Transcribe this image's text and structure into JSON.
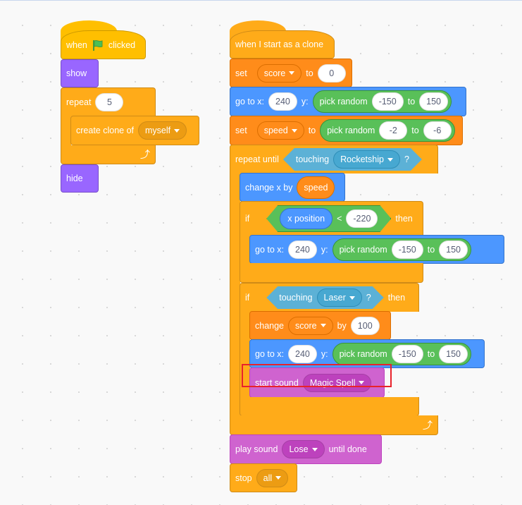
{
  "script1": {
    "when": "when",
    "clicked": "clicked",
    "flag_icon": "green-flag",
    "show": "show",
    "repeat": "repeat",
    "repeat_count": "5",
    "create_clone": "create clone of",
    "clone_target": "myself",
    "hide": "hide"
  },
  "script2": {
    "hat": "when I start as a clone",
    "set1": {
      "label": "set",
      "var": "score",
      "to": "to",
      "value": "0"
    },
    "goto1": {
      "label": "go to x:",
      "x": "240",
      "y": "y:",
      "pick": "pick random",
      "from": "-150",
      "to": "to",
      "max": "150"
    },
    "set2": {
      "label": "set",
      "var": "speed",
      "to": "to",
      "pick": "pick random",
      "from": "-2",
      "to2": "to",
      "max": "-6"
    },
    "repeat_until": {
      "label": "repeat until",
      "touching": "touching",
      "target": "Rocketship",
      "q": "?"
    },
    "change_x": {
      "label": "change x by",
      "value": "speed"
    },
    "if1": {
      "label": "if",
      "reporter": "x position",
      "op": "<",
      "value": "-220",
      "then": "then"
    },
    "goto2": {
      "label": "go to x:",
      "x": "240",
      "y": "y:",
      "pick": "pick random",
      "from": "-150",
      "to": "to",
      "max": "150"
    },
    "if2": {
      "label": "if",
      "touching": "touching",
      "target": "Laser",
      "q": "?",
      "then": "then"
    },
    "change_score": {
      "label": "change",
      "var": "score",
      "by": "by",
      "value": "100"
    },
    "goto3": {
      "label": "go to x:",
      "x": "240",
      "y": "y:",
      "pick": "pick random",
      "from": "-150",
      "to": "to",
      "max": "150"
    },
    "start_sound": {
      "label": "start sound",
      "sound": "Magic Spell"
    },
    "play_sound": {
      "label": "play sound",
      "sound": "Lose",
      "until": "until done"
    },
    "stop": {
      "label": "stop",
      "option": "all"
    }
  },
  "colors": {
    "events": "#FFBF00",
    "looks": "#9966FF",
    "control": "#FFAB19",
    "motion": "#4C97FF",
    "variables": "#FF8C1A",
    "operators": "#59C059",
    "sensing": "#5CB1D6",
    "sound": "#CF63CF",
    "highlight": "#E8222B"
  }
}
